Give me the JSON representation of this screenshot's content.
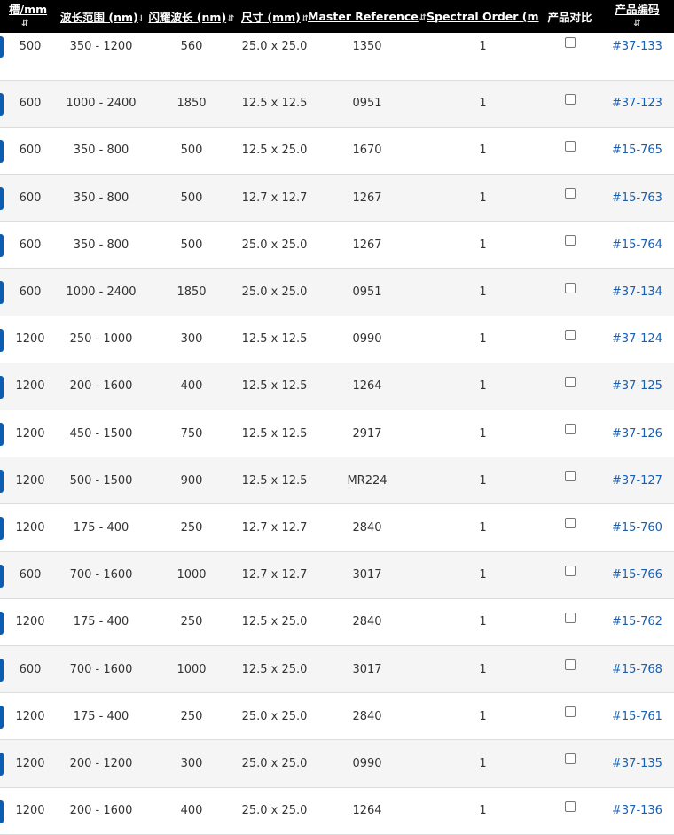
{
  "headers": [
    {
      "label": "槽/mm",
      "sort": "⇵"
    },
    {
      "label": "波长范围 (nm)",
      "sort": "⇵"
    },
    {
      "label": "闪耀波长 (nm)",
      "sort": "⇵"
    },
    {
      "label": "尺寸 (mm)",
      "sort": "⇵"
    },
    {
      "label": "Master Reference",
      "sort": "⇵"
    },
    {
      "label": "Spectral Order (m)",
      "sort": "⇵"
    },
    {
      "label": "产品对比",
      "sort": ""
    },
    {
      "label": "产品编码",
      "sort": "⇵"
    }
  ],
  "rows": [
    [
      "500",
      "350 - 1200",
      "560",
      "25.0 x 25.0",
      "1350",
      "1",
      "#37-133"
    ],
    [
      "600",
      "1000 - 2400",
      "1850",
      "12.5 x 12.5",
      "0951",
      "1",
      "#37-123"
    ],
    [
      "600",
      "350 - 800",
      "500",
      "12.5 x 25.0",
      "1670",
      "1",
      "#15-765"
    ],
    [
      "600",
      "350 - 800",
      "500",
      "12.7 x 12.7",
      "1267",
      "1",
      "#15-763"
    ],
    [
      "600",
      "350 - 800",
      "500",
      "25.0 x 25.0",
      "1267",
      "1",
      "#15-764"
    ],
    [
      "600",
      "1000 - 2400",
      "1850",
      "25.0 x 25.0",
      "0951",
      "1",
      "#37-134"
    ],
    [
      "1200",
      "250 - 1000",
      "300",
      "12.5 x 12.5",
      "0990",
      "1",
      "#37-124"
    ],
    [
      "1200",
      "200 - 1600",
      "400",
      "12.5 x 12.5",
      "1264",
      "1",
      "#37-125"
    ],
    [
      "1200",
      "450 - 1500",
      "750",
      "12.5 x 12.5",
      "2917",
      "1",
      "#37-126"
    ],
    [
      "1200",
      "500 - 1500",
      "900",
      "12.5 x 12.5",
      "MR224",
      "1",
      "#37-127"
    ],
    [
      "1200",
      "175 - 400",
      "250",
      "12.7 x 12.7",
      "2840",
      "1",
      "#15-760"
    ],
    [
      "600",
      "700 - 1600",
      "1000",
      "12.7 x 12.7",
      "3017",
      "1",
      "#15-766"
    ],
    [
      "1200",
      "175 - 400",
      "250",
      "12.5 x 25.0",
      "2840",
      "1",
      "#15-762"
    ],
    [
      "600",
      "700 - 1600",
      "1000",
      "12.5 x 25.0",
      "3017",
      "1",
      "#15-768"
    ],
    [
      "1200",
      "175 - 400",
      "250",
      "25.0 x 25.0",
      "2840",
      "1",
      "#15-761"
    ],
    [
      "1200",
      "200 - 1200",
      "300",
      "25.0 x 25.0",
      "0990",
      "1",
      "#37-135"
    ],
    [
      "1200",
      "200 - 1600",
      "400",
      "25.0 x 25.0",
      "1264",
      "1",
      "#37-136"
    ]
  ],
  "colors": {
    "header_bg": "#000000",
    "accent": "#0a5db3",
    "link": "#1b5fb0"
  }
}
